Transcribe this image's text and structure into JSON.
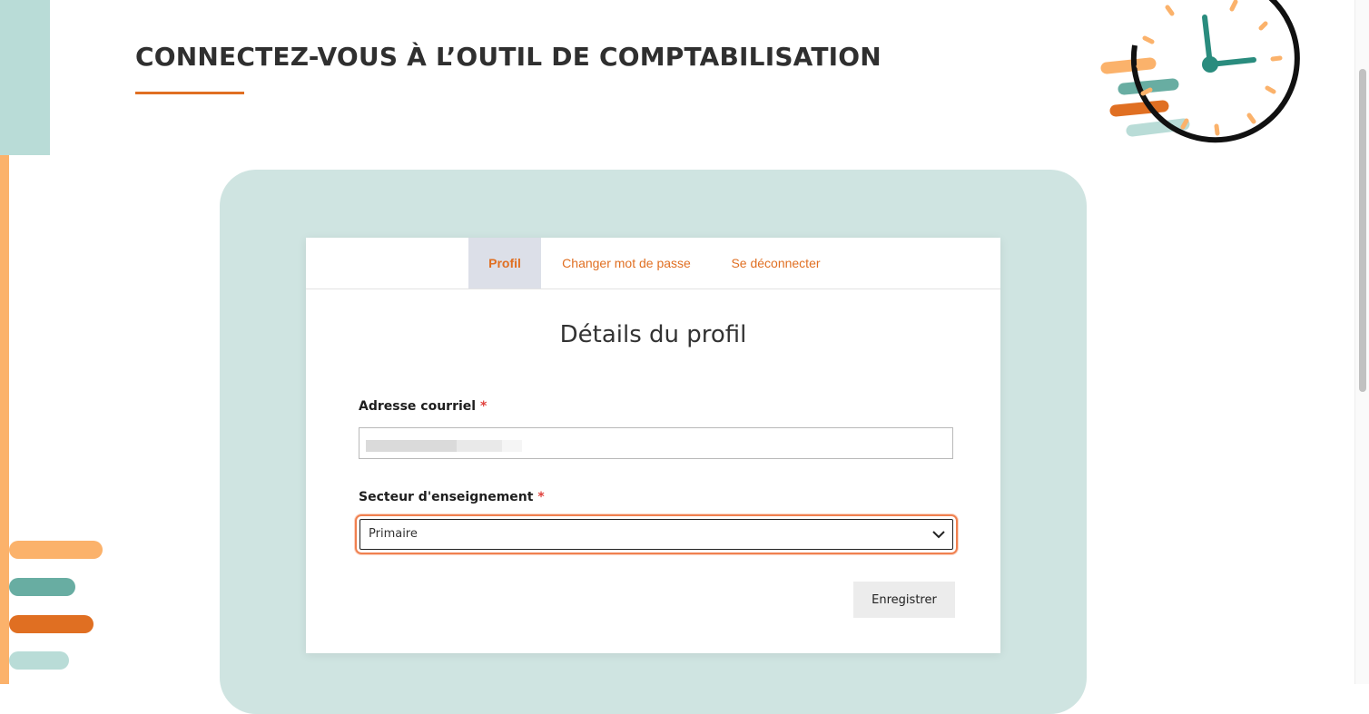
{
  "header": {
    "title": "CONNECTEZ-VOUS À L’OUTIL DE COMPTABILISATION"
  },
  "tabs": [
    {
      "label": "Profil",
      "active": true
    },
    {
      "label": "Changer mot de passe",
      "active": false
    },
    {
      "label": "Se déconnecter",
      "active": false
    }
  ],
  "profile": {
    "heading": "Détails du profil",
    "email": {
      "label": "Adresse courriel",
      "required_mark": "*",
      "value_redacted": true
    },
    "sector": {
      "label": "Secteur d'enseignement",
      "required_mark": "*",
      "selected": "Primaire",
      "focused": true
    },
    "save_label": "Enregistrer"
  },
  "decor": {
    "clock_icon": "clock-icon",
    "chevron_icon": "chevron-down-icon"
  },
  "colors": {
    "accent_orange": "#e06f22",
    "light_orange": "#fbb26b",
    "teal": "#5fab9f",
    "light_teal": "#b9dcd7",
    "panel_teal": "#cfe4e1",
    "focus_ring": "#f0804f",
    "required": "#e0413c"
  }
}
